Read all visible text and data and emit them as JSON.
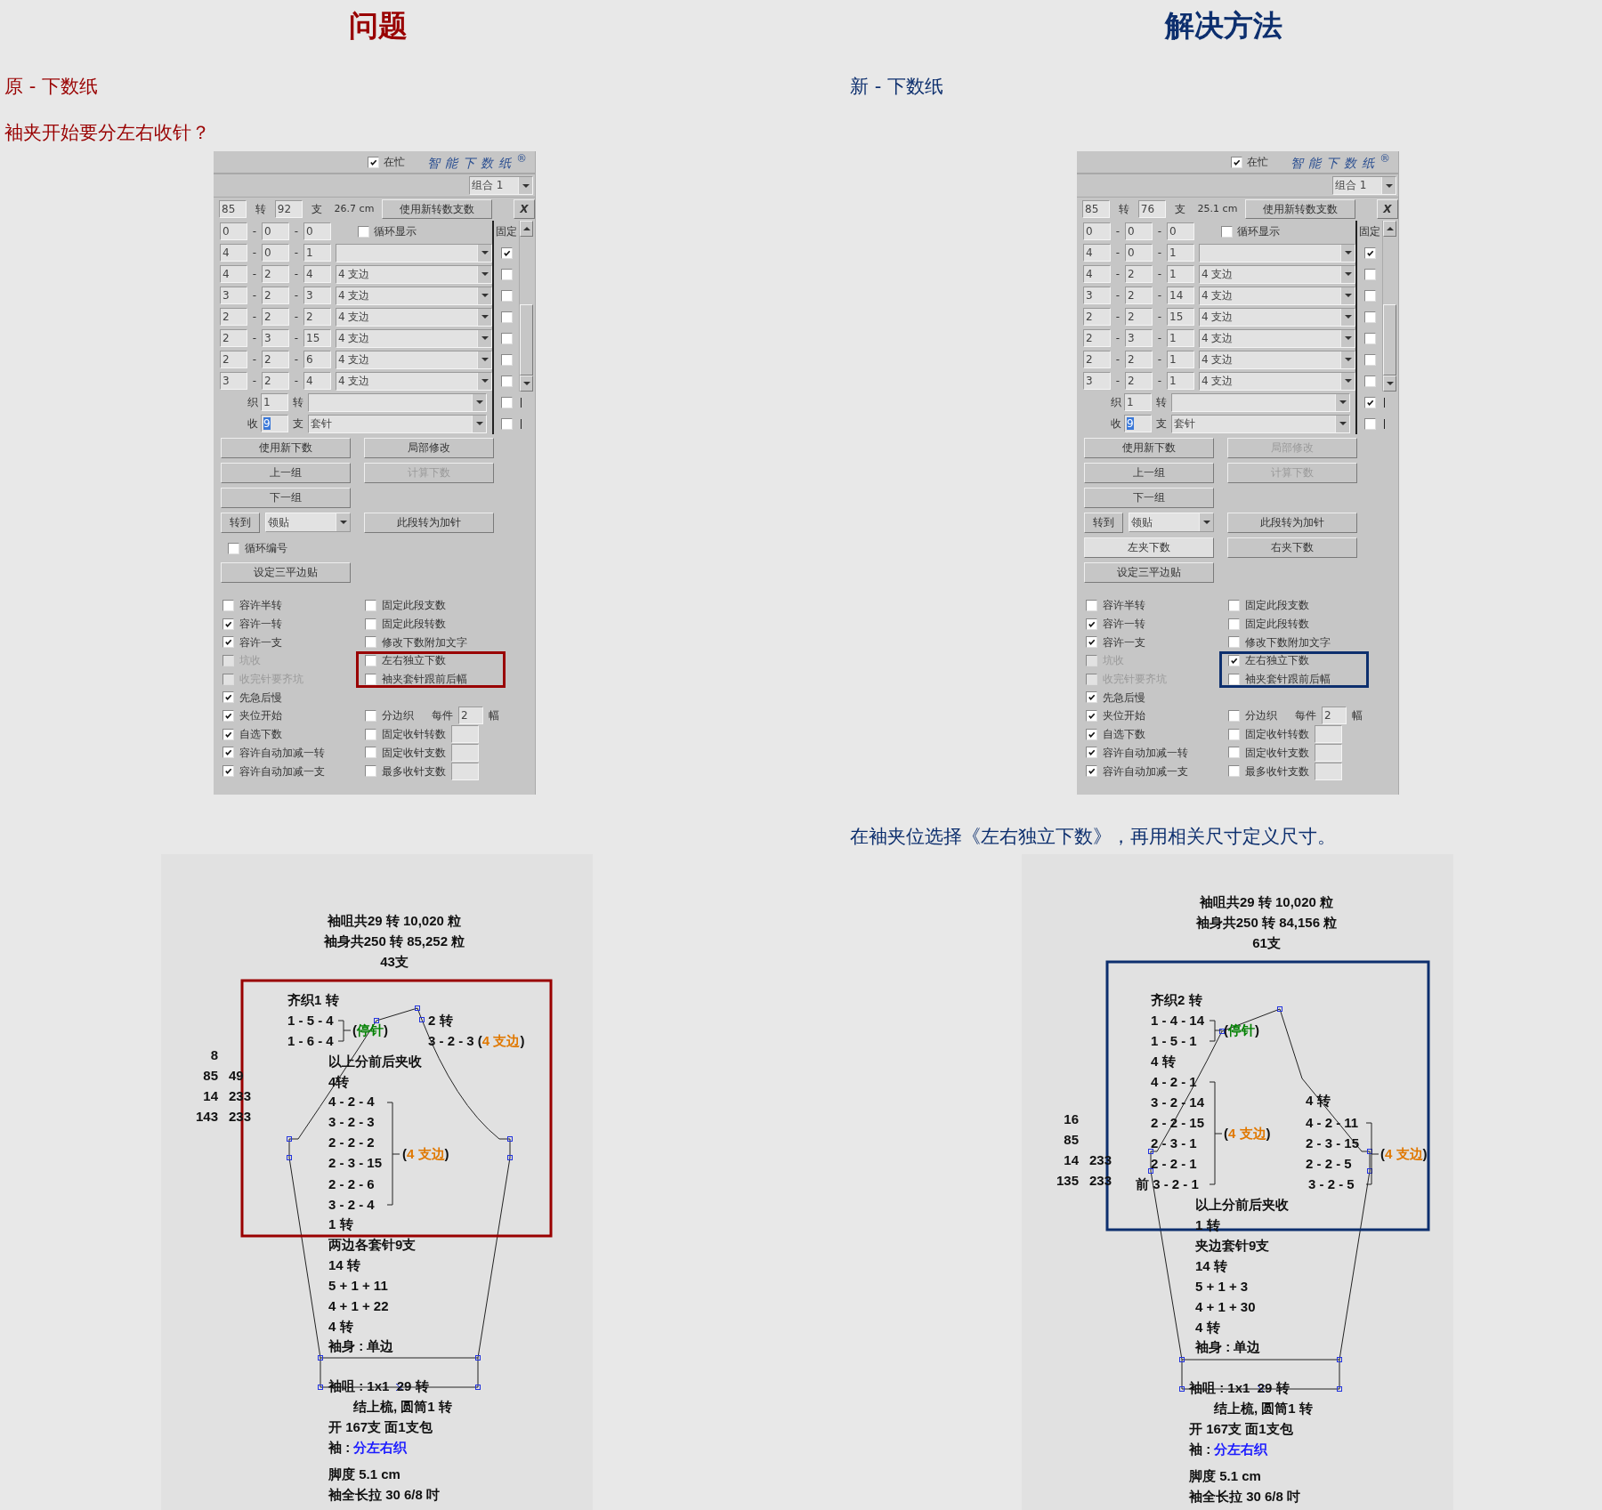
{
  "columns": [
    {
      "color": "#990000",
      "heading": "问题",
      "label": "原 - 下数纸",
      "question": "袖夹开始要分左右收针？",
      "panel": {
        "busy": {
          "label": "在忙",
          "checked": true
        },
        "brand": "智能下数纸$^{®}$",
        "group": "组合 1",
        "rows_value": "85",
        "rows_unit": "转",
        "stitches_value": "92",
        "stitches_unit": "支",
        "length": "26.7 cm",
        "apply_button": "使用新转数支数",
        "close_button": "X",
        "separator": "-",
        "first_row": {
          "values": [
            "0",
            "0",
            "0"
          ],
          "loop_display": {
            "label": "循环显示",
            "checked": false
          }
        },
        "fixed_header": "固定",
        "rows": [
          {
            "values": [
              "4",
              "0",
              "1"
            ],
            "fixed": true
          },
          {
            "values": [
              "4",
              "2",
              "4"
            ],
            "option": "4 支边",
            "fixed": false
          },
          {
            "values": [
              "3",
              "2",
              "3"
            ],
            "option": "4 支边",
            "fixed": false
          },
          {
            "values": [
              "2",
              "2",
              "2"
            ],
            "option": "4 支边",
            "fixed": false
          },
          {
            "values": [
              "2",
              "3",
              "15"
            ],
            "option": "4 支边",
            "fixed": false
          },
          {
            "values": [
              "2",
              "2",
              "6"
            ],
            "option": "4 支边",
            "fixed": false
          },
          {
            "values": [
              "3",
              "2",
              "4"
            ],
            "option": "4 支边",
            "fixed": false
          }
        ],
        "extra_rows": [
          {
            "label": "织",
            "value": "1",
            "unit": "转",
            "fixed": false,
            "selected": false
          },
          {
            "label": "收",
            "value": "9",
            "unit": "支",
            "option": "套针",
            "fixed": false,
            "selected": true
          }
        ],
        "buttons": [
          [
            {
              "kind": "button",
              "label": "使用新下数",
              "disabled": false
            },
            {
              "kind": "button",
              "label": "局部修改",
              "disabled": false
            }
          ],
          [
            {
              "kind": "button",
              "label": "上一组",
              "disabled": false
            },
            {
              "kind": "button",
              "label": "计算下数",
              "disabled": true
            }
          ],
          [
            {
              "kind": "button",
              "label": "下一组",
              "disabled": false
            }
          ],
          [
            {
              "kind": "jump",
              "label": "转到",
              "option": "领贴"
            },
            {
              "kind": "button",
              "label": "此段转为加针",
              "disabled": false
            }
          ],
          [
            {
              "kind": "checkbox",
              "label": "循环编号",
              "checked": false
            }
          ],
          [
            {
              "kind": "button",
              "label": "设定三平边贴",
              "disabled": false
            }
          ]
        ],
        "options": [
          {
            "left": {
              "label": "容许半转",
              "checked": false,
              "disabled": false
            },
            "right": {
              "kind": "check",
              "label": "固定此段支数",
              "checked": false,
              "highlighted": false
            }
          },
          {
            "left": {
              "label": "容许一转",
              "checked": true,
              "disabled": false
            },
            "right": {
              "kind": "check",
              "label": "固定此段转数",
              "checked": false,
              "highlighted": false
            }
          },
          {
            "left": {
              "label": "容许一支",
              "checked": true,
              "disabled": false
            },
            "right": {
              "kind": "check",
              "label": "修改下数附加文字",
              "checked": false,
              "highlighted": false
            }
          },
          {
            "left": {
              "label": "坑收",
              "checked": false,
              "disabled": true
            },
            "right": {
              "kind": "check",
              "label": "左右独立下数",
              "checked": false,
              "highlighted": true
            }
          },
          {
            "left": {
              "label": "收完针要齐坑",
              "checked": false,
              "disabled": true
            },
            "right": {
              "kind": "check",
              "label": "袖夹套针跟前后幅",
              "checked": false,
              "highlighted": true
            }
          },
          {
            "left": {
              "label": "先急后慢",
              "checked": true,
              "disabled": false
            }
          },
          {
            "left": {
              "label": "夹位开始",
              "checked": true,
              "disabled": false
            },
            "right": {
              "kind": "split",
              "label": "分边织",
              "checked": false,
              "per": "每件",
              "value": "2",
              "unit": "幅"
            }
          },
          {
            "left": {
              "label": "自选下数",
              "checked": true,
              "disabled": false
            },
            "right": {
              "kind": "field",
              "label": "固定收针转数",
              "checked": false
            }
          },
          {
            "left": {
              "label": "容许自动加减一转",
              "checked": true,
              "disabled": false
            },
            "right": {
              "kind": "field",
              "label": "固定收针支数",
              "checked": false
            }
          },
          {
            "left": {
              "label": "容许自动加减一支",
              "checked": true,
              "disabled": false
            },
            "right": {
              "kind": "field",
              "label": "最多收针支数",
              "checked": false
            }
          }
        ]
      },
      "diagram": {
        "summary": [
          "袖咀共29 转 10,020 粒",
          "袖身共250 转 85,252 粒",
          "43支"
        ],
        "side_numbers": [
          [
            "8"
          ],
          [
            "85",
            "49"
          ],
          [
            "14",
            "233"
          ],
          [
            "143",
            "233"
          ]
        ],
        "labels": [
          [
            {
              "text": "齐织1 转"
            }
          ],
          [
            {
              "text": "1 - 5 - 4"
            }
          ],
          [
            {
              "text": "1 - 6 - 4"
            }
          ],
          [
            {
              "text": "("
            },
            {
              "text": "停针",
              "color": "#008000"
            },
            {
              "text": ")"
            }
          ],
          [
            {
              "text": "2 转"
            }
          ],
          [
            {
              "text": "3 - 2 - 3 ("
            },
            {
              "text": "4 支边",
              "color": "#e07800"
            },
            {
              "text": ")"
            }
          ],
          [
            {
              "text": "以上分前后夹收"
            }
          ],
          [
            {
              "text": "4转"
            }
          ],
          [
            {
              "text": "4 - 2 - 4"
            }
          ],
          [
            {
              "text": "3 - 2 - 3"
            }
          ],
          [
            {
              "text": "2 - 2 - 2"
            }
          ],
          [
            {
              "text": "2 - 3 - 15"
            }
          ],
          [
            {
              "text": "2 - 2 - 6"
            }
          ],
          [
            {
              "text": "3 - 2 - 4"
            }
          ],
          [
            {
              "text": "("
            },
            {
              "text": "4 支边",
              "color": "#e07800"
            },
            {
              "text": ")"
            }
          ],
          [
            {
              "text": "1 转"
            }
          ],
          [
            {
              "text": "两边各套针9支"
            }
          ],
          [
            {
              "text": "14 转"
            }
          ],
          [
            {
              "text": "5 + 1 + 11"
            }
          ],
          [
            {
              "text": "4 + 1 + 22"
            }
          ],
          [
            {
              "text": "4 转"
            }
          ],
          [
            {
              "text": "袖身 : 单边"
            }
          ],
          [
            {
              "text": "袖咀 : 1x1  29 转"
            }
          ],
          [
            {
              "text": "结上梳, 圆筒1 转"
            }
          ],
          [
            {
              "text": "开 167支 面1支包"
            }
          ],
          [
            {
              "text": "袖 : "
            },
            {
              "text": "分左右织",
              "color": "#1a1aff"
            }
          ],
          [
            {
              "text": "脚度 5.1 cm"
            }
          ],
          [
            {
              "text": "袖全长拉 30 6/8 吋"
            }
          ]
        ]
      }
    },
    {
      "color": "#0d2f6e",
      "heading": "解决方法",
      "label": "新 - 下数纸",
      "note": "在袖夹位选择《左右独立下数》，再用相关尺寸定义尺寸。",
      "panel": {
        "busy": {
          "label": "在忙",
          "checked": true
        },
        "brand": "智能下数纸$^{®}$",
        "group": "组合 1",
        "rows_value": "85",
        "rows_unit": "转",
        "stitches_value": "76",
        "stitches_unit": "支",
        "length": "25.1 cm",
        "apply_button": "使用新转数支数",
        "close_button": "X",
        "separator": "-",
        "first_row": {
          "values": [
            "0",
            "0",
            "0"
          ],
          "loop_display": {
            "label": "循环显示",
            "checked": false
          }
        },
        "fixed_header": "固定",
        "rows": [
          {
            "values": [
              "4",
              "0",
              "1"
            ],
            "fixed": true
          },
          {
            "values": [
              "4",
              "2",
              "1"
            ],
            "option": "4 支边",
            "fixed": false
          },
          {
            "values": [
              "3",
              "2",
              "14"
            ],
            "option": "4 支边",
            "fixed": false
          },
          {
            "values": [
              "2",
              "2",
              "15"
            ],
            "option": "4 支边",
            "fixed": false
          },
          {
            "values": [
              "2",
              "3",
              "1"
            ],
            "option": "4 支边",
            "fixed": false
          },
          {
            "values": [
              "2",
              "2",
              "1"
            ],
            "option": "4 支边",
            "fixed": false
          },
          {
            "values": [
              "3",
              "2",
              "1"
            ],
            "option": "4 支边",
            "fixed": false
          }
        ],
        "extra_rows": [
          {
            "label": "织",
            "value": "1",
            "unit": "转",
            "fixed": true,
            "selected": false
          },
          {
            "label": "收",
            "value": "9",
            "unit": "支",
            "option": "套针",
            "fixed": false,
            "selected": true
          }
        ],
        "buttons": [
          [
            {
              "kind": "button",
              "label": "使用新下数",
              "disabled": false
            },
            {
              "kind": "button",
              "label": "局部修改",
              "disabled": true
            }
          ],
          [
            {
              "kind": "button",
              "label": "上一组",
              "disabled": false
            },
            {
              "kind": "button",
              "label": "计算下数",
              "disabled": true
            }
          ],
          [
            {
              "kind": "button",
              "label": "下一组",
              "disabled": false
            }
          ],
          [
            {
              "kind": "jump",
              "label": "转到",
              "option": "领贴"
            },
            {
              "kind": "button",
              "label": "此段转为加针",
              "disabled": false
            }
          ],
          [
            {
              "kind": "toggle",
              "label": "左夹下数",
              "selected": true
            },
            {
              "kind": "toggle",
              "label": "右夹下数",
              "selected": false
            }
          ],
          [
            {
              "kind": "button",
              "label": "设定三平边贴",
              "disabled": false
            }
          ]
        ],
        "options": [
          {
            "left": {
              "label": "容许半转",
              "checked": false,
              "disabled": false
            },
            "right": {
              "kind": "check",
              "label": "固定此段支数",
              "checked": false,
              "highlighted": false
            }
          },
          {
            "left": {
              "label": "容许一转",
              "checked": true,
              "disabled": false
            },
            "right": {
              "kind": "check",
              "label": "固定此段转数",
              "checked": false,
              "highlighted": false
            }
          },
          {
            "left": {
              "label": "容许一支",
              "checked": true,
              "disabled": false
            },
            "right": {
              "kind": "check",
              "label": "修改下数附加文字",
              "checked": false,
              "highlighted": false
            }
          },
          {
            "left": {
              "label": "坑收",
              "checked": false,
              "disabled": true
            },
            "right": {
              "kind": "check",
              "label": "左右独立下数",
              "checked": true,
              "highlighted": true
            }
          },
          {
            "left": {
              "label": "收完针要齐坑",
              "checked": false,
              "disabled": true
            },
            "right": {
              "kind": "check",
              "label": "袖夹套针跟前后幅",
              "checked": false,
              "highlighted": true
            }
          },
          {
            "left": {
              "label": "先急后慢",
              "checked": true,
              "disabled": false
            }
          },
          {
            "left": {
              "label": "夹位开始",
              "checked": true,
              "disabled": false
            },
            "right": {
              "kind": "split",
              "label": "分边织",
              "checked": false,
              "per": "每件",
              "value": "2",
              "unit": "幅"
            }
          },
          {
            "left": {
              "label": "自选下数",
              "checked": true,
              "disabled": false
            },
            "right": {
              "kind": "field",
              "label": "固定收针转数",
              "checked": false
            }
          },
          {
            "left": {
              "label": "容许自动加减一转",
              "checked": true,
              "disabled": false
            },
            "right": {
              "kind": "field",
              "label": "固定收针支数",
              "checked": false
            }
          },
          {
            "left": {
              "label": "容许自动加减一支",
              "checked": true,
              "disabled": false
            },
            "right": {
              "kind": "field",
              "label": "最多收针支数",
              "checked": false
            }
          }
        ]
      },
      "diagram": {
        "summary": [
          "袖咀共29 转 10,020 粒",
          "袖身共250 转 84,156 粒",
          "61支"
        ],
        "side_numbers": [
          [
            "16"
          ],
          [
            "85"
          ],
          [
            "14",
            "233"
          ],
          [
            "135",
            "233"
          ]
        ],
        "labels": [
          [
            {
              "text": "齐织2 转"
            }
          ],
          [
            {
              "text": "1 - 4 - 14"
            }
          ],
          [
            {
              "text": "1 - 5 - 1"
            }
          ],
          [
            {
              "text": "("
            },
            {
              "text": "停针",
              "color": "#008000"
            },
            {
              "text": ")"
            }
          ],
          [
            {
              "text": "4 转"
            }
          ],
          [
            {
              "text": "4 - 2 - 1"
            }
          ],
          [
            {
              "text": "3 - 2 - 14"
            }
          ],
          [
            {
              "text": "2 - 2 - 15"
            }
          ],
          [
            {
              "text": "2 - 3 - 1"
            }
          ],
          [
            {
              "text": "2 - 2 - 1"
            }
          ],
          [
            {
              "text": "前 3 - 2 - 1"
            }
          ],
          [
            {
              "text": "("
            },
            {
              "text": "4 支边",
              "color": "#e07800"
            },
            {
              "text": ")"
            }
          ],
          [
            {
              "text": "4 转"
            }
          ],
          [
            {
              "text": "4 - 2 - 11"
            }
          ],
          [
            {
              "text": "2 - 3 - 15"
            }
          ],
          [
            {
              "text": "2 - 2 - 5"
            }
          ],
          [
            {
              "text": "3 - 2 - 5"
            }
          ],
          [
            {
              "text": "("
            },
            {
              "text": "4 支边",
              "color": "#e07800"
            },
            {
              "text": ")"
            }
          ],
          [
            {
              "text": "以上分前后夹收"
            }
          ],
          [
            {
              "text": "1 转"
            }
          ],
          [
            {
              "text": "夹边套针9支"
            }
          ],
          [
            {
              "text": "14 转"
            }
          ],
          [
            {
              "text": "5 + 1 + 3"
            }
          ],
          [
            {
              "text": "4 + 1 + 30"
            }
          ],
          [
            {
              "text": "4 转"
            }
          ],
          [
            {
              "text": "袖身 : 单边"
            }
          ],
          [
            {
              "text": "袖咀 : 1x1  29 转"
            }
          ],
          [
            {
              "text": "结上梳, 圆筒1 转"
            }
          ],
          [
            {
              "text": "开 167支 面1支包"
            }
          ],
          [
            {
              "text": "袖 : "
            },
            {
              "text": "分左右织",
              "color": "#1a1aff"
            }
          ],
          [
            {
              "text": "脚度 5.1 cm"
            }
          ],
          [
            {
              "text": "袖全长拉 30 6/8 吋"
            }
          ]
        ]
      }
    }
  ]
}
